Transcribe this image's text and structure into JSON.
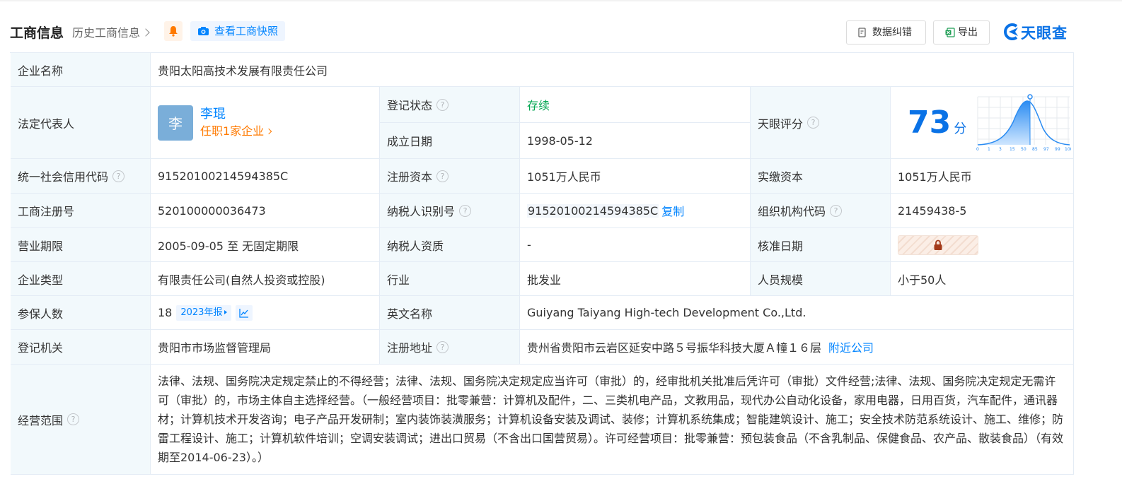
{
  "header": {
    "title": "工商信息",
    "history_link": "历史工商信息",
    "snapshot_label": "查看工商快照",
    "data_error_label": "数据纠错",
    "export_label": "导出",
    "logo_text": "天眼查"
  },
  "rows": {
    "company_name": {
      "label": "企业名称",
      "value": "贵阳太阳高技术发展有限责任公司"
    },
    "legal_rep": {
      "label": "法定代表人",
      "avatar_char": "李",
      "name": "李琨",
      "role": "任职1家企业"
    },
    "reg_status": {
      "label": "登记状态",
      "value": "存续"
    },
    "founded": {
      "label": "成立日期",
      "value": "1998-05-12"
    },
    "tianyan_score": {
      "label": "天眼评分",
      "score": "73",
      "unit": "分",
      "axis": [
        "0",
        "1",
        "3",
        "15",
        "50",
        "85",
        "97",
        "99",
        "100"
      ]
    },
    "credit_code": {
      "label": "统一社会信用代码",
      "value": "91520100214594385C"
    },
    "reg_capital": {
      "label": "注册资本",
      "value": "1051万人民币"
    },
    "paid_capital": {
      "label": "实缴资本",
      "value": "1051万人民币"
    },
    "reg_number": {
      "label": "工商注册号",
      "value": "520100000036473"
    },
    "taxpayer_id": {
      "label": "纳税人识别号",
      "value": "91520100214594385C",
      "copy_label": "复制"
    },
    "org_code": {
      "label": "组织机构代码",
      "value": "21459438-5"
    },
    "term": {
      "label": "营业期限",
      "value": "2005-09-05 至 无固定期限"
    },
    "taxpayer_qual": {
      "label": "纳税人资质",
      "value": "-"
    },
    "approval_date": {
      "label": "核准日期"
    },
    "company_type": {
      "label": "企业类型",
      "value": "有限责任公司(自然人投资或控股)"
    },
    "industry": {
      "label": "行业",
      "value": "批发业"
    },
    "staff_size": {
      "label": "人员规模",
      "value": "小于50人"
    },
    "insured": {
      "label": "参保人数",
      "value": "18",
      "report_label": "2023年报"
    },
    "english_name": {
      "label": "英文名称",
      "value": "Guiyang Taiyang High-tech Development Co.,Ltd."
    },
    "reg_authority": {
      "label": "登记机关",
      "value": "贵阳市市场监督管理局"
    },
    "reg_address": {
      "label": "注册地址",
      "value": "贵州省贵阳市云岩区延安中路５号振华科技大厦Ａ幢１６层",
      "nearby_label": "附近公司"
    },
    "scope": {
      "label": "经营范围",
      "value": "法律、法规、国务院决定规定禁止的不得经营；法律、法规、国务院决定规定应当许可（审批）的，经审批机关批准后凭许可（审批）文件经营;法律、法规、国务院决定规定无需许可（审批）的，市场主体自主选择经营。（一般经营项目：批零兼营：计算机及配件，二、三类机电产品，文教用品，现代办公自动化设备，家用电器，日用百货，汽车配件，通讯器材；计算机技术开发咨询；电子产品开发研制；室内装饰装潢服务；计算机设备安装及调试、装修；计算机系统集成；智能建筑设计、施工；安全技术防范系统设计、施工、维修；防雷工程设计、施工；计算机软件培训；空调安装调试；进出口贸易（不含出口国营贸易）。许可经营项目：批零兼营：预包装食品（不含乳制品、保健食品、农产品、散装食品）（有效期至2014-06-23）。）"
    }
  },
  "help_icon_char": "?",
  "colors": {
    "accent": "#0084ff",
    "status_green": "#00a650",
    "role_orange": "#ff7a00",
    "label_bg": "#f2f9fc"
  }
}
